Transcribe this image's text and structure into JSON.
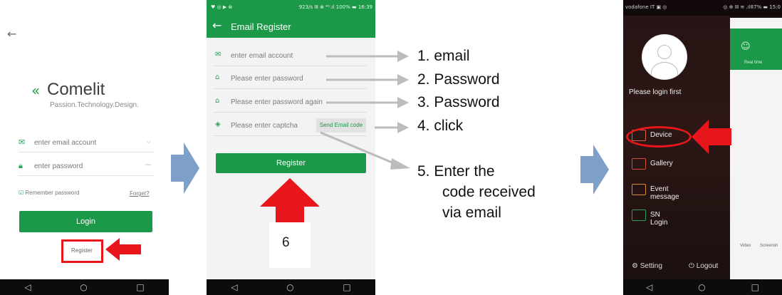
{
  "panel1": {
    "logo_text": "Comelit",
    "logo_tagline": "Passion.Technology.Design.",
    "email_placeholder": "enter email account",
    "password_placeholder": "enter password",
    "remember_label": "Remember password",
    "forget_link": "Forget?",
    "login_button": "Login",
    "register_link": "Register"
  },
  "panel2": {
    "status_left": "♥ ◎ ▶ ⊗",
    "status_right": "923/s ⅠⅡ ⊗ ⁴ᴳ.ıl 100% ▬ 16:39",
    "title": "Email Register",
    "email_placeholder": "enter email account",
    "password_placeholder": "Please enter password",
    "password_again_placeholder": "Please enter password again",
    "captcha_placeholder": "Please enter captcha",
    "send_code_button": "Send Email code",
    "register_button": "Register",
    "step6_label": "6"
  },
  "panel3": {
    "status_left": "vodafone IT ▣ ◎",
    "status_right": "◎ ⊕ ⅠⅡ ≋ .ıl87% ▬ 15:0",
    "login_prompt": "Please login first",
    "menu": [
      "Device",
      "Gallery",
      "Event message",
      "SN Login"
    ],
    "setting_label": "Setting",
    "logout_label": "Logout",
    "realtime_label": "Real time",
    "video_label": "Video",
    "screenshot_label": "Screensh"
  },
  "annotations": {
    "step1": "1. email",
    "step2": "2. Password",
    "step3": "3. Password",
    "step4": "4. click",
    "step5_line1": "5. Enter the",
    "step5_line2": "code received",
    "step5_line3": "via email"
  },
  "colors": {
    "brand_green": "#1b9848",
    "highlight_red": "#e8161a",
    "flow_arrow_blue": "#7d9fc8"
  }
}
